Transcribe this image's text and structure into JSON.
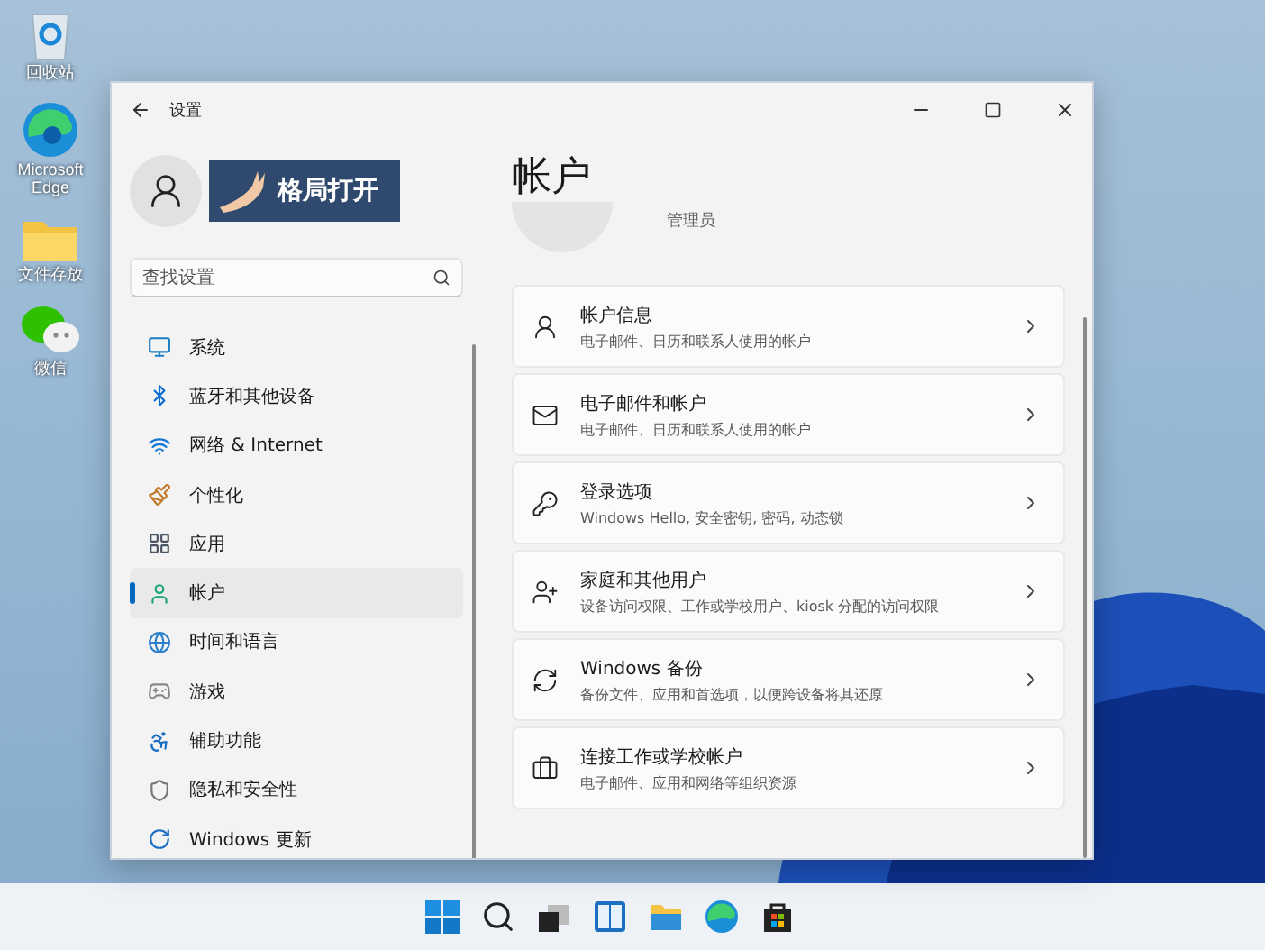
{
  "desktop_icons": [
    {
      "label": "回收站",
      "kind": "recycle"
    },
    {
      "label": "Microsoft Edge",
      "kind": "edge"
    },
    {
      "label": "文件存放",
      "kind": "folder"
    },
    {
      "label": "微信",
      "kind": "wechat"
    }
  ],
  "window": {
    "title": "设置"
  },
  "profile": {
    "sticker_text": "格局打开"
  },
  "search": {
    "placeholder": "查找设置"
  },
  "sidebar": {
    "items": [
      {
        "label": "系统",
        "kind": "system",
        "selected": false
      },
      {
        "label": "蓝牙和其他设备",
        "kind": "bluetooth",
        "selected": false
      },
      {
        "label": "网络 & Internet",
        "kind": "network",
        "selected": false
      },
      {
        "label": "个性化",
        "kind": "brush",
        "selected": false
      },
      {
        "label": "应用",
        "kind": "apps",
        "selected": false
      },
      {
        "label": "帐户",
        "kind": "account",
        "selected": true
      },
      {
        "label": "时间和语言",
        "kind": "time",
        "selected": false
      },
      {
        "label": "游戏",
        "kind": "gaming",
        "selected": false
      },
      {
        "label": "辅助功能",
        "kind": "accessibility",
        "selected": false
      },
      {
        "label": "隐私和安全性",
        "kind": "privacy",
        "selected": false
      },
      {
        "label": "Windows 更新",
        "kind": "update",
        "selected": false
      }
    ]
  },
  "page": {
    "title": "帐户",
    "role": "管理员"
  },
  "cards": [
    {
      "title": "帐户信息",
      "subtitle": "电子邮件、日历和联系人使用的帐户",
      "kind": "info"
    },
    {
      "title": "电子邮件和帐户",
      "subtitle": "电子邮件、日历和联系人使用的帐户",
      "kind": "mail"
    },
    {
      "title": "登录选项",
      "subtitle": "Windows Hello, 安全密钥, 密码, 动态锁",
      "kind": "key"
    },
    {
      "title": "家庭和其他用户",
      "subtitle": "设备访问权限、工作或学校用户、kiosk 分配的访问权限",
      "kind": "family"
    },
    {
      "title": "Windows 备份",
      "subtitle": "备份文件、应用和首选项，以便跨设备将其还原",
      "kind": "backup"
    },
    {
      "title": "连接工作或学校帐户",
      "subtitle": "电子邮件、应用和网络等组织资源",
      "kind": "work"
    }
  ],
  "taskbar": {
    "items": [
      {
        "kind": "start"
      },
      {
        "kind": "search"
      },
      {
        "kind": "taskview"
      },
      {
        "kind": "widgets"
      },
      {
        "kind": "explorer"
      },
      {
        "kind": "edge"
      },
      {
        "kind": "store"
      }
    ]
  }
}
